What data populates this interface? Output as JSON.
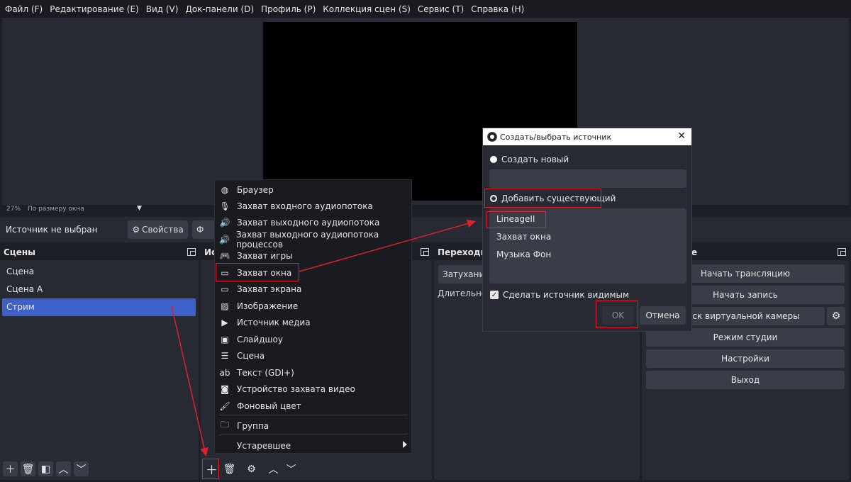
{
  "menubar": {
    "items": [
      "Файл (F)",
      "Редактирование (E)",
      "Вид (V)",
      "Док-панели (D)",
      "Профиль (P)",
      "Коллекция сцен (S)",
      "Сервис (T)",
      "Справка (H)"
    ]
  },
  "preview": {
    "zoom": "27%",
    "scale_mode": "По размеру окна",
    "dropdown_glyph": "▼"
  },
  "source_toolbar": {
    "no_source": "Источник не выбран",
    "properties_label": "Свойства",
    "filters_label": "Ф"
  },
  "scenes": {
    "title": "Сцены",
    "items": [
      {
        "label": "Сцена",
        "selected": false
      },
      {
        "label": "Сцена А",
        "selected": false
      },
      {
        "label": "Стрим",
        "selected": true
      }
    ]
  },
  "sources": {
    "title": "Ис"
  },
  "transitions": {
    "title": "Переходы",
    "selected": "Затухание",
    "duration_label": "Длительность"
  },
  "controls": {
    "title": "е",
    "start_stream": "Начать трансляцию",
    "start_record": "Начать запись",
    "virtual_cam": "Запуск виртуальной камеры",
    "studio_mode": "Режим студии",
    "settings": "Настройки",
    "exit": "Выход"
  },
  "context_menu": {
    "items": [
      {
        "label": "Браузер",
        "icon": "globe-icon",
        "glyph": "◍"
      },
      {
        "label": "Захват входного аудиопотока",
        "icon": "microphone-icon",
        "glyph": "🎙"
      },
      {
        "label": "Захват выходного аудиопотока",
        "icon": "speaker-icon",
        "glyph": "🔊"
      },
      {
        "label": "Захват выходного аудиопотока процессов",
        "icon": "speaker-icon",
        "glyph": "🔊"
      },
      {
        "label": "Захват игры",
        "icon": "gamepad-icon",
        "glyph": "🎮"
      },
      {
        "label": "Захват окна",
        "icon": "window-icon",
        "glyph": "▭"
      },
      {
        "label": "Захват экрана",
        "icon": "monitor-icon",
        "glyph": "▭"
      },
      {
        "label": "Изображение",
        "icon": "image-icon",
        "glyph": "▨"
      },
      {
        "label": "Источник медиа",
        "icon": "play-icon",
        "glyph": "▶"
      },
      {
        "label": "Слайдшоу",
        "icon": "slideshow-icon",
        "glyph": "▣"
      },
      {
        "label": "Сцена",
        "icon": "list-icon",
        "glyph": "☰"
      },
      {
        "label": "Текст (GDI+)",
        "icon": "text-icon",
        "glyph": "ab"
      },
      {
        "label": "Устройство захвата видео",
        "icon": "camera-icon",
        "glyph": "◙"
      },
      {
        "label": "Фоновый цвет",
        "icon": "brush-icon",
        "glyph": "🖌"
      }
    ],
    "group": {
      "label": "Группа",
      "icon": "folder-icon",
      "glyph": "🗀"
    },
    "deprecated": {
      "label": "Устаревшее"
    }
  },
  "dialog": {
    "title": "Создать/выбрать источник",
    "close_glyph": "✕",
    "create_new": "Создать новый",
    "name_value": "",
    "add_existing": "Добавить существующий",
    "existing": [
      "LineageII",
      "Захват окна",
      "Музыка Фон"
    ],
    "make_visible": "Сделать источник видимым",
    "check_glyph": "✓",
    "ok": "OK",
    "cancel": "Отмена"
  },
  "colors": {
    "accent": "#3d61c9",
    "annotation": "#e0202a",
    "panel": "#272a33",
    "background": "#1d1f26"
  }
}
